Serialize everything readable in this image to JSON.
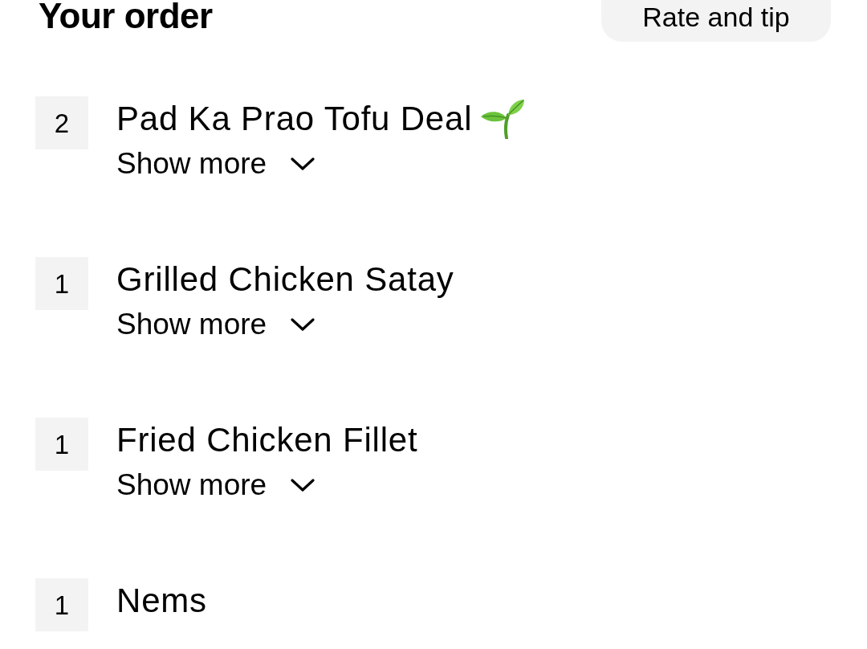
{
  "header": {
    "title": "Your order",
    "action": "Rate and tip"
  },
  "items": [
    {
      "quantity": "2",
      "name": "Pad Ka Prao Tofu Deal",
      "plant_based": true,
      "toggle": {
        "label": "Show more",
        "expanded": false
      }
    },
    {
      "quantity": "1",
      "name": "Grilled Chicken Satay",
      "plant_based": false,
      "toggle": {
        "label": "Show more",
        "expanded": false
      }
    },
    {
      "quantity": "1",
      "name": "Fried Chicken Fillet",
      "plant_based": false,
      "toggle": {
        "label": "Show more",
        "expanded": false
      }
    },
    {
      "quantity": "1",
      "name": "Nems",
      "plant_based": false
    }
  ]
}
